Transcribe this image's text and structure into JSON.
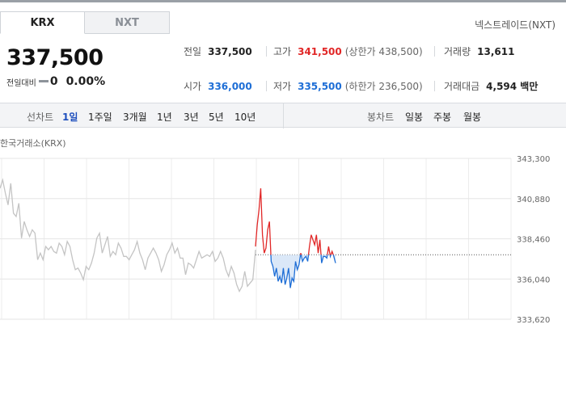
{
  "market_tabs": [
    {
      "label": "KRX",
      "active": true
    },
    {
      "label": "NXT",
      "active": false
    }
  ],
  "nxt_link": "넥스트레이드(NXT)",
  "price": {
    "current": "337,500",
    "change_label": "전일대비",
    "change_value": "0",
    "change_percent": "0.00%"
  },
  "stats": {
    "prev_close": {
      "label": "전일",
      "value": "337,500"
    },
    "high": {
      "label": "고가",
      "value": "341,500",
      "sub": "(상한가 438,500)"
    },
    "volume": {
      "label": "거래량",
      "value": "13,611"
    },
    "open": {
      "label": "시가",
      "value": "336,000"
    },
    "low": {
      "label": "저가",
      "value": "335,500",
      "sub": "(하한가 236,500)"
    },
    "amount": {
      "label": "거래대금",
      "value": "4,594 백만"
    }
  },
  "period_bar": {
    "line_label": "선차트",
    "line_items": [
      "1일",
      "1주일",
      "3개월",
      "1년",
      "3년",
      "5년",
      "10년"
    ],
    "active_index": 0,
    "candle_label": "봉차트",
    "candle_items": [
      "일봉",
      "주봉",
      "월봉"
    ]
  },
  "exchange_label": "한국거래소(KRX)",
  "colors": {
    "up": "#e12727",
    "down": "#1e6ed6",
    "prev_grey": "#c4c4c4"
  },
  "chart_data": {
    "type": "line",
    "ylim": [
      333620,
      343300
    ],
    "y_ticks": [
      "343,300",
      "340,880",
      "338,460",
      "336,040",
      "333,620"
    ],
    "y_tick_values": [
      343300,
      340880,
      338460,
      336040,
      333620
    ],
    "baseline": 337500,
    "series": [
      {
        "values": [
          341500,
          342000,
          341200,
          340500,
          341800,
          340000,
          339800,
          340600,
          338500,
          339500,
          339000,
          338600,
          339000,
          338800,
          337200,
          337600,
          337200,
          338000,
          337800,
          338000,
          337700,
          337600,
          338200,
          338000,
          337500,
          338300,
          338000,
          337200,
          336600,
          336700,
          336400,
          336000,
          336800,
          336600,
          337000,
          337600,
          338500,
          338800,
          337600,
          338100,
          338600,
          337400,
          337700,
          337500,
          338200,
          337900,
          337400,
          337400,
          337200,
          337500,
          337800,
          338300,
          337600,
          337200,
          336600,
          337300,
          337600,
          337900,
          337600,
          337200,
          336500,
          336900,
          337500,
          337800,
          338200,
          337600,
          337900,
          337300,
          337300,
          336300,
          337000,
          336900,
          336700,
          337200,
          337700,
          337300,
          337400,
          337500,
          337400,
          337700,
          337100,
          337300,
          337700,
          337300,
          336600,
          336200,
          336800,
          336400,
          335700,
          335300,
          335600,
          336500,
          335600,
          335800,
          336000,
          337800
        ]
      },
      {
        "values": [
          338000,
          339300,
          340200,
          341500,
          338700,
          337600,
          337900,
          339000,
          339500,
          337100,
          336800,
          336200,
          336700,
          335900,
          336200,
          335800,
          336700,
          335700,
          336100,
          336700,
          335500,
          336100,
          335900,
          337100,
          336600,
          336900,
          337600,
          337100,
          337300,
          337400,
          337100,
          338000,
          338700,
          338400,
          338100,
          338700,
          337600,
          338400,
          337000,
          337400,
          337400,
          337300,
          338000,
          337400,
          337700,
          337400,
          337000
        ]
      }
    ]
  }
}
